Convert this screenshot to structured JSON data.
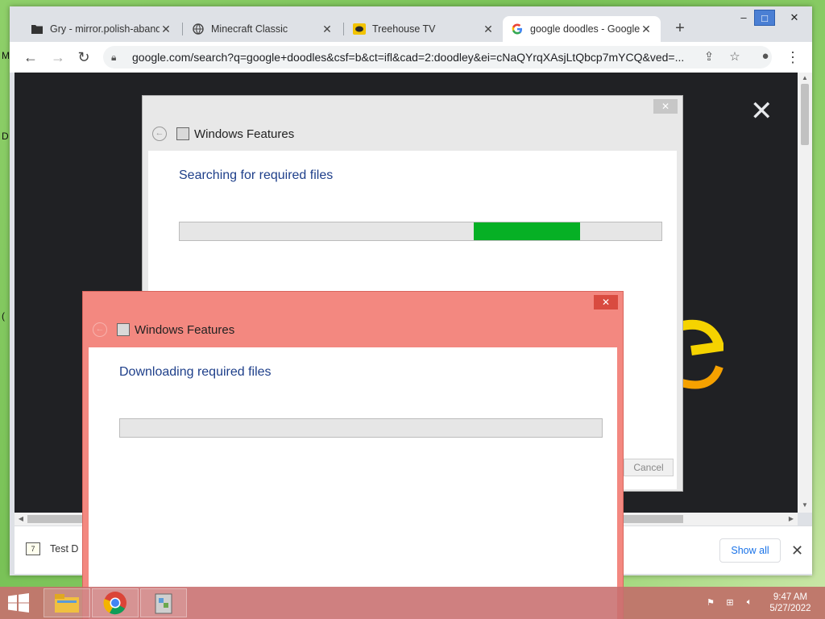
{
  "browser": {
    "tabs": [
      {
        "title": "Gry - mirror.polish-aband",
        "icon": "folder-icon"
      },
      {
        "title": "Minecraft Classic",
        "icon": "globe-icon"
      },
      {
        "title": "Treehouse TV",
        "icon": "treehouse-icon"
      },
      {
        "title": "google doodles - Google",
        "icon": "google-icon",
        "active": true
      }
    ],
    "url": "google.com/search?q=google+doodles&csf=b&ct=ifl&cad=2:doodley&ei=cNaQYrqXAsjLtQbcp7mYCQ&ved=..."
  },
  "dialog_back": {
    "title": "Windows Features",
    "status": "Searching for required files",
    "progress": 0.22,
    "progress_start": 0.61,
    "cancel_label": "Cancel"
  },
  "dialog_front": {
    "title": "Windows Features",
    "status": "Downloading required files",
    "progress": 0
  },
  "downloads": {
    "item": "Test D",
    "show_all_label": "Show all"
  },
  "taskbar": {
    "time": "9:47 AM",
    "date": "5/27/2022"
  },
  "colors": {
    "progress_fill": "#06b025",
    "front_dialog_frame": "#f38880",
    "taskbar": "#c86e6e"
  }
}
